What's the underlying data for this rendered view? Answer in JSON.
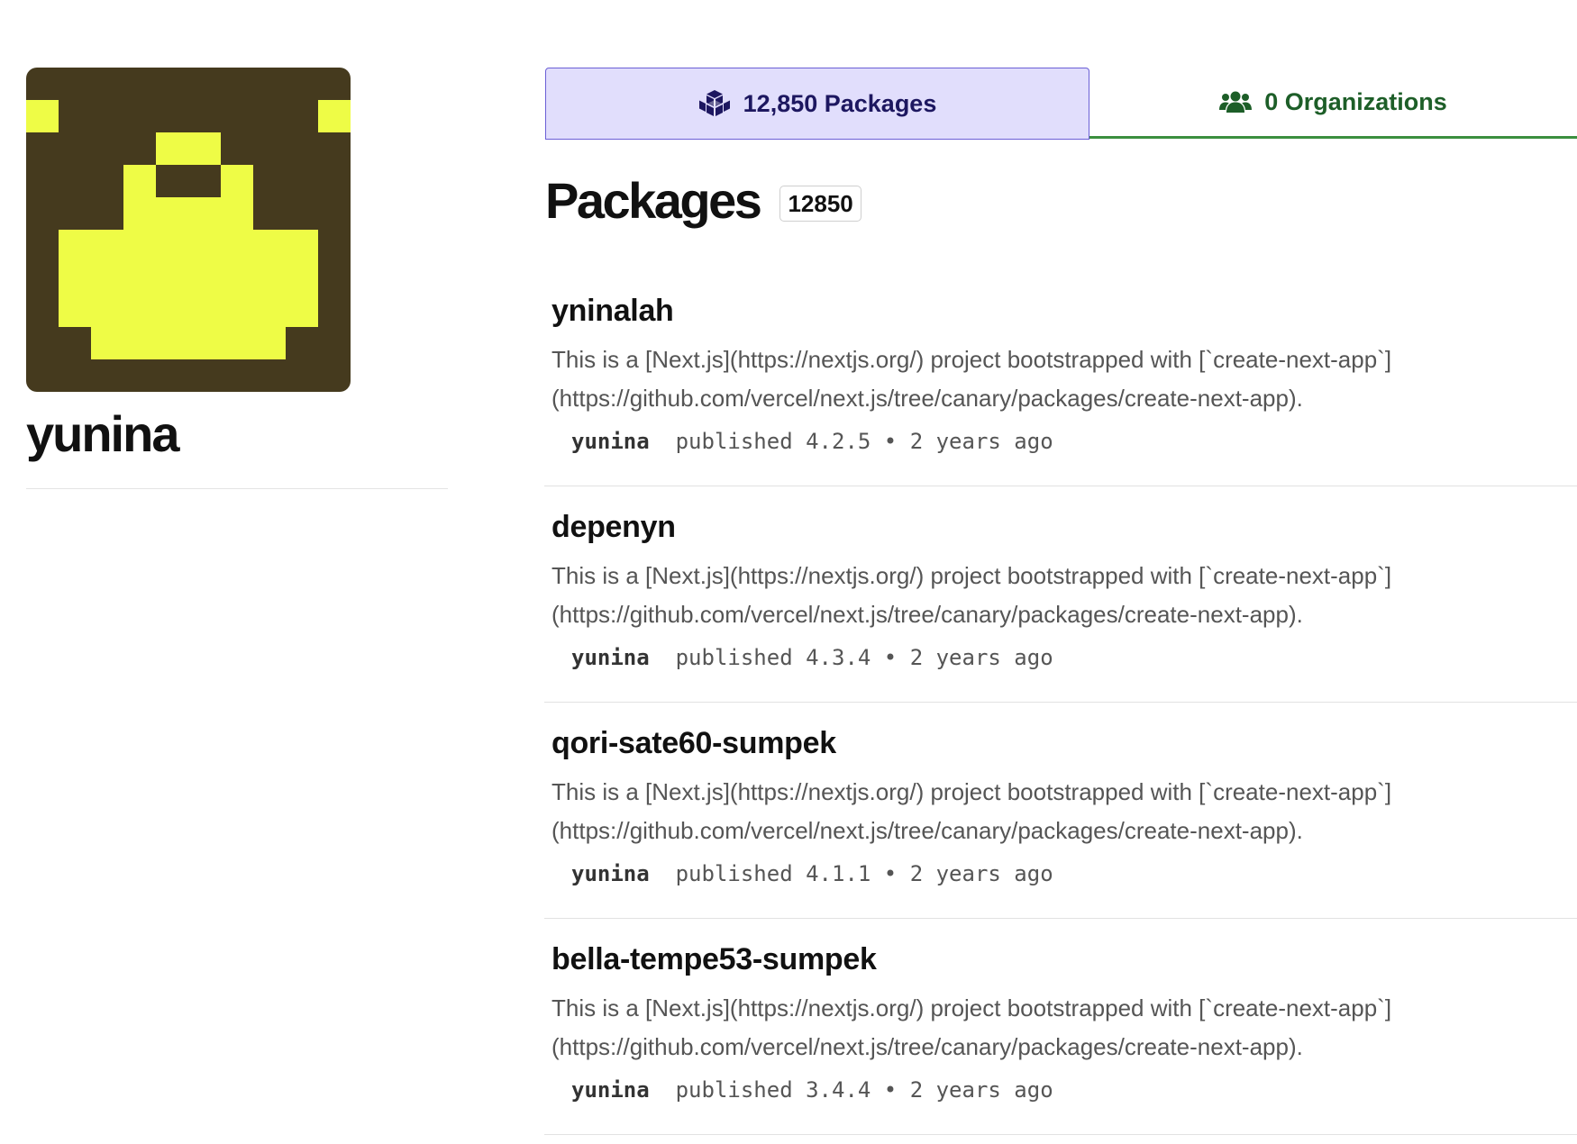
{
  "profile": {
    "username": "yunina",
    "avatar": {
      "background": "#453a1e",
      "foreground": "#eefc46"
    }
  },
  "tabs": {
    "packages": {
      "label": "12,850 Packages",
      "icon": "cubes-icon",
      "active": true
    },
    "organizations": {
      "label": "0 Organizations",
      "icon": "users-icon",
      "active": false
    }
  },
  "packages_section": {
    "title": "Packages",
    "count": "12850"
  },
  "packages": [
    {
      "name": "yninalah",
      "description": "This is a [Next.js](https://nextjs.org/) project bootstrapped with [`create-next-app`](https://github.com/vercel/next.js/tree/canary/packages/create-next-app).",
      "author": "yunina",
      "published": "published 4.2.5 • 2 years ago"
    },
    {
      "name": "depenyn",
      "description": "This is a [Next.js](https://nextjs.org/) project bootstrapped with [`create-next-app`](https://github.com/vercel/next.js/tree/canary/packages/create-next-app).",
      "author": "yunina",
      "published": "published 4.3.4 • 2 years ago"
    },
    {
      "name": "qori-sate60-sumpek",
      "description": "This is a [Next.js](https://nextjs.org/) project bootstrapped with [`create-next-app`](https://github.com/vercel/next.js/tree/canary/packages/create-next-app).",
      "author": "yunina",
      "published": "published 4.1.1 • 2 years ago"
    },
    {
      "name": "bella-tempe53-sumpek",
      "description": "This is a [Next.js](https://nextjs.org/) project bootstrapped with [`create-next-app`](https://github.com/vercel/next.js/tree/canary/packages/create-next-app).",
      "author": "yunina",
      "published": "published 3.4.4 • 2 years ago"
    }
  ],
  "colors": {
    "tab_active_bg": "#e1defc",
    "tab_active_border": "#6b5fd6",
    "tab_active_text": "#1d1760",
    "tab_inactive_text": "#1d5e28",
    "tab_inactive_underline": "#3b8f3f"
  }
}
